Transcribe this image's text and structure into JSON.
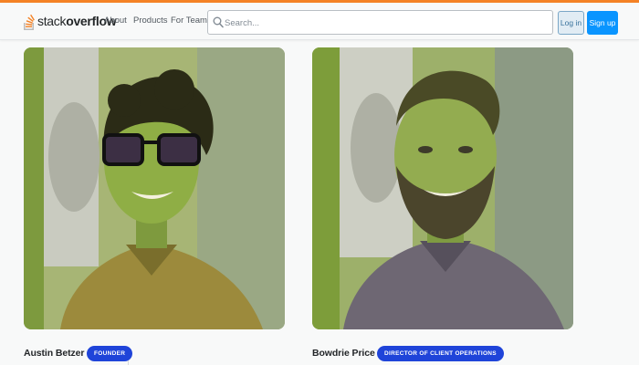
{
  "header": {
    "logo_stack": "stack",
    "logo_overflow": "overflow",
    "nav": [
      "About",
      "Products",
      "For Teams"
    ],
    "search_placeholder": "Search...",
    "login_label": "Log in",
    "signup_label": "Sign up"
  },
  "colors": {
    "accent": "#f48225",
    "primary_button": "#0a95ff",
    "badge": "#1f44d9"
  },
  "people": [
    {
      "name": "Austin Betzer",
      "role": "FOUNDER"
    },
    {
      "name": "Bowdrie Price",
      "role": "DIRECTOR OF CLIENT OPERATIONS"
    }
  ]
}
